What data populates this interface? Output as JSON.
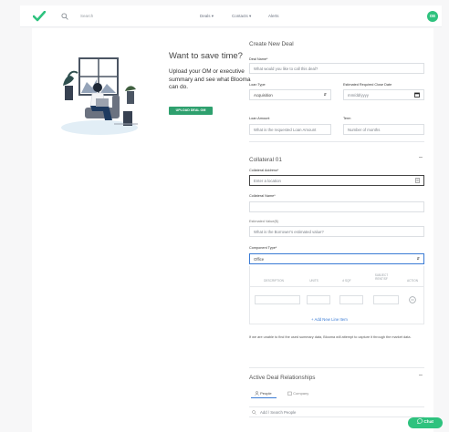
{
  "header": {
    "search_placeholder": "Search",
    "nav": [
      "Deals ▾",
      "Contacts ▾",
      "Alerts"
    ],
    "avatar_initials": "OE"
  },
  "promo": {
    "title": "Want to save time?",
    "body": "Upload your OM or executive summary and see what Blooma can do.",
    "button": "UPLOAD DEAL OM"
  },
  "form": {
    "title": "Create New Deal",
    "deal_name": {
      "label": "Deal Name*",
      "placeholder": "What would you like to call this deal?"
    },
    "loan_type": {
      "label": "Loan Type",
      "value": "Acquisition"
    },
    "close_date": {
      "label": "Estimated Required Close Date",
      "placeholder": "mm/dd/yyyy"
    },
    "loan_amount": {
      "label": "Loan Amount",
      "placeholder": "What is the requested Loan Amount"
    },
    "term": {
      "label": "Term",
      "placeholder": "Number of months"
    },
    "collateral": {
      "title": "Collateral 01",
      "address_label": "Collateral Address*",
      "address_placeholder": "Enter a location",
      "name_label": "Collateral Name*",
      "name_value": "",
      "est_value_label": "Estimated Value($)",
      "est_value_placeholder": "What is the Borrower's estimated value?",
      "component_label": "Component Type*",
      "component_value": "Office",
      "table_headers": [
        "DESCRIPTION",
        "UNITS",
        "# SQF",
        "SUBJECT RENT/SF",
        "ACTION"
      ],
      "add_line": "+ Add New Line Item",
      "note": "If we are unable to find the used summary data, Blooma will attempt to capture it through the market data."
    },
    "relationships": {
      "title": "Active Deal Relationships",
      "tabs": [
        "People",
        "Company"
      ],
      "search_placeholder": "Add / Search People"
    }
  },
  "chat_label": "Chat",
  "colors": {
    "accent": "#2ec27e",
    "button": "#2ea06e",
    "link": "#3a7bd5"
  }
}
